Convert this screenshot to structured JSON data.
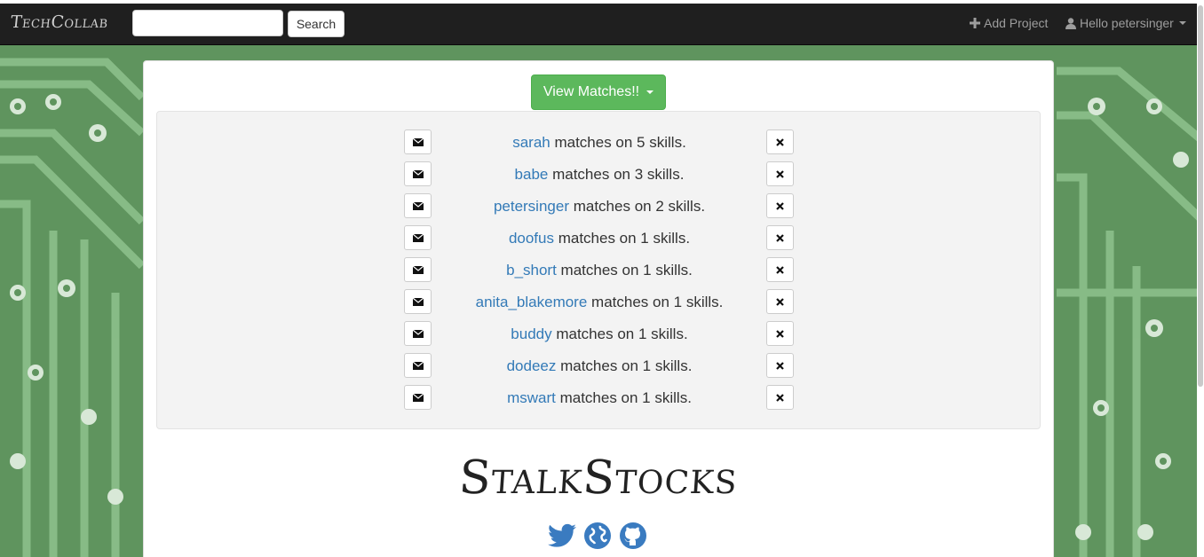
{
  "navbar": {
    "brand": "TechCollab",
    "search_placeholder": "",
    "search_button": "Search",
    "add_project": "Add Project",
    "user_greeting": "Hello petersinger"
  },
  "main": {
    "view_matches_label": "View Matches!!",
    "matches": [
      {
        "user": "sarah",
        "text": " matches on 5 skills."
      },
      {
        "user": "babe",
        "text": " matches on 3 skills."
      },
      {
        "user": "petersinger",
        "text": " matches on 2 skills."
      },
      {
        "user": "doofus",
        "text": " matches on 1 skills."
      },
      {
        "user": "b_short",
        "text": " matches on 1 skills."
      },
      {
        "user": "anita_blakemore",
        "text": " matches on 1 skills."
      },
      {
        "user": "buddy",
        "text": " matches on 1 skills."
      },
      {
        "user": "dodeez",
        "text": " matches on 1 skills."
      },
      {
        "user": "mswart",
        "text": " matches on 1 skills."
      }
    ],
    "footer_logo": "StalkStocks",
    "social_icons": [
      "twitter-icon",
      "globe-icon",
      "github-icon"
    ]
  },
  "colors": {
    "navbar_bg": "#1f1f1f",
    "success": "#5cb85c",
    "link": "#337ab7",
    "circuit_green": "#5b8f5b"
  }
}
